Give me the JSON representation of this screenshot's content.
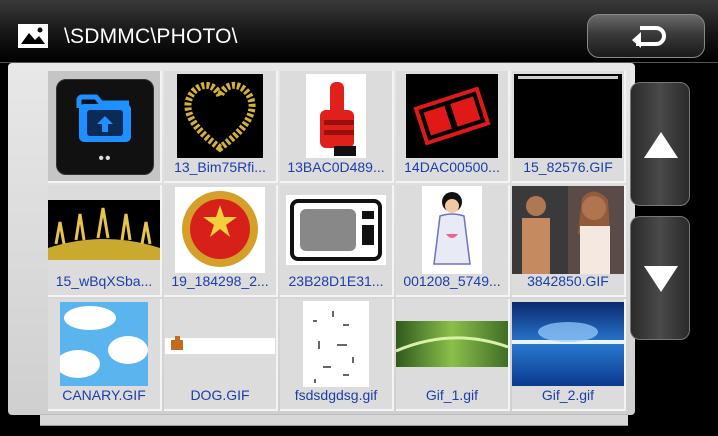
{
  "title_bar": {
    "path": "\\SDMMC\\PHOTO\\",
    "icon": "photo-icon",
    "back_icon": "return-arrow-icon"
  },
  "grid": {
    "items": [
      {
        "label": "",
        "kind": "parent-folder"
      },
      {
        "label": "13_Bim75Rfi...",
        "kind": "image"
      },
      {
        "label": "13BAC0D489...",
        "kind": "image"
      },
      {
        "label": "14DAC00500...",
        "kind": "image"
      },
      {
        "label": "15_82576.GIF",
        "kind": "image"
      },
      {
        "label": "15_wBqXSba...",
        "kind": "image"
      },
      {
        "label": "19_184298_2...",
        "kind": "image"
      },
      {
        "label": "23B28D1E31...",
        "kind": "image"
      },
      {
        "label": "001208_5749...",
        "kind": "image"
      },
      {
        "label": "3842850.GIF",
        "kind": "image"
      },
      {
        "label": "CANARY.GIF",
        "kind": "image"
      },
      {
        "label": "DOG.GIF",
        "kind": "image"
      },
      {
        "label": "fsdsdgdsg.gif",
        "kind": "image"
      },
      {
        "label": "Gif_1.gif",
        "kind": "image"
      },
      {
        "label": "Gif_2.gif",
        "kind": "image"
      }
    ],
    "parent_folder_dots": "••"
  },
  "scroll": {
    "up_icon": "triangle-up-icon",
    "down_icon": "triangle-down-icon"
  },
  "colors": {
    "label": "#1c3ea8",
    "cell_bg": "#dcdcdc",
    "accent_folder": "#1e90ff"
  }
}
